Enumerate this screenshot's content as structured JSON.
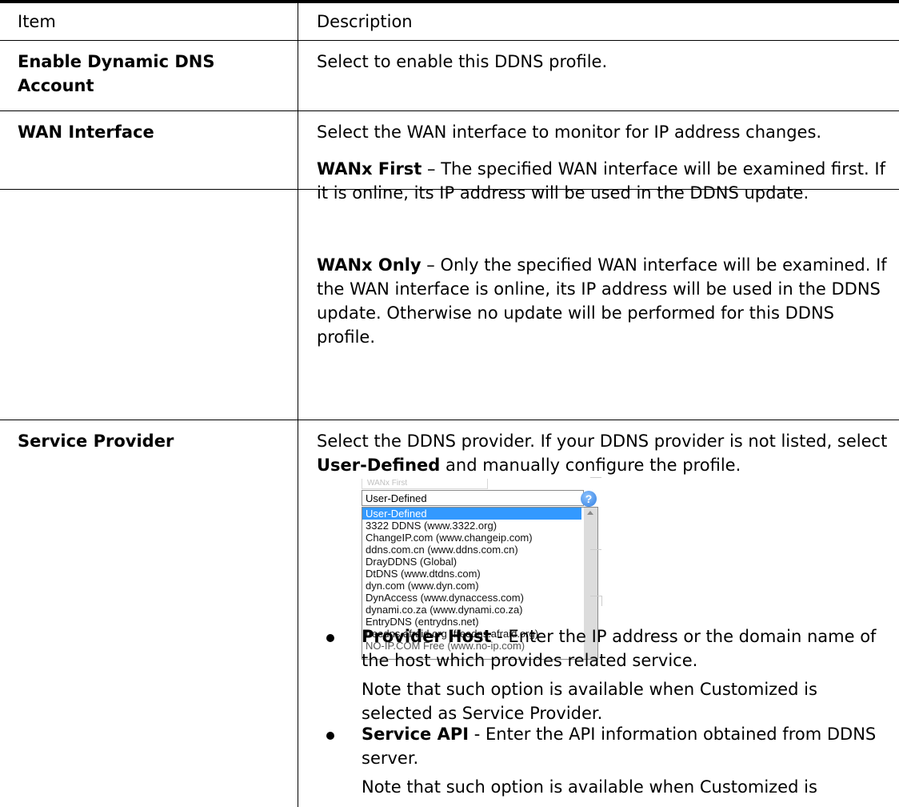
{
  "table": {
    "headers": {
      "item": "Item",
      "description": "Description"
    },
    "rows": [
      {
        "item": "Enable Dynamic DNS Account",
        "description": "Select to enable this DDNS profile."
      },
      {
        "item": "WAN Interface",
        "description": "Select the WAN interface to monitor for IP address changes.",
        "options": [
          {
            "term": "WANx First",
            "text": " – The specified WAN interface will be examined first. If it is online, its IP address will be used in the DDNS update."
          },
          {
            "term": "WANx Only",
            "text": " – Only the specified WAN interface will be examined. If the WAN interface is online, its IP address will be used in the DDNS update. Otherwise no update will be performed for this DDNS profile."
          }
        ]
      },
      {
        "item": "Service Provider",
        "description_pre": "Select the DDNS provider. If your DDNS provider is not listed, select ",
        "description_bold": "User-Defined",
        "description_post": " and manually configure the profile.",
        "dropdown": {
          "ghost_label": "WANx First",
          "selected": "User-Defined",
          "options": [
            "User-Defined",
            "3322 DDNS (www.3322.org)",
            "ChangeIP.com (www.changeip.com)",
            "ddns.com.cn (www.ddns.com.cn)",
            "DrayDDNS (Global)",
            "DtDNS (www.dtdns.com)",
            "dyn.com (www.dyn.com)",
            "DynAccess (www.dynaccess.com)",
            "dynami.co.za (www.dynami.co.za)",
            "EntryDNS (entrydns.net)",
            "freedns.afraid.org (freedns.afraid.org)",
            "NO-IP.COM Free (www.no-ip.com)"
          ],
          "help_icon": "?"
        },
        "bullets": [
          {
            "term": "Provider Host",
            "text": " - Enter the IP address or the domain name of the host which provides related service.",
            "note": "Note that such option is available when Customized is selected as Service Provider."
          },
          {
            "term": "Service API",
            "text": " - Enter the API information obtained from DDNS server.",
            "note": "Note that such option is available when Customized is"
          }
        ]
      }
    ]
  }
}
